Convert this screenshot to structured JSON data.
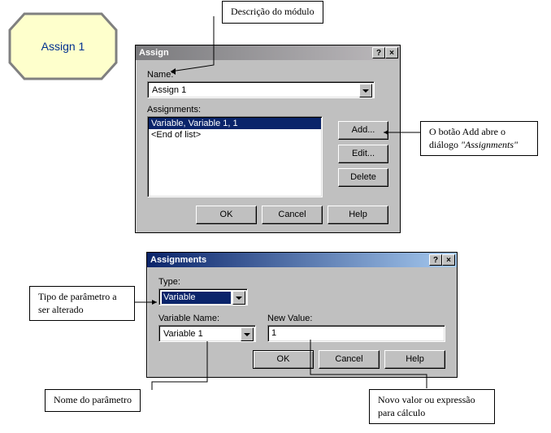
{
  "module": {
    "label": "Assign 1"
  },
  "annotations": {
    "module_desc": "Descrição do módulo",
    "add_button_note": "O botão Add abre o diálogo \"Assignments\"",
    "add_button_note_prefix": "O botão Add abre o diálogo ",
    "add_button_note_italic": "\"Assignments\"",
    "param_type": "Tipo de parâmetro a ser alterado",
    "param_name": "Nome do parâmetro",
    "new_value": "Novo valor ou expressão para cálculo"
  },
  "assignDialog": {
    "title": "Assign",
    "name_label": "Name:",
    "name_value": "Assign 1",
    "assignments_label": "Assignments:",
    "list": {
      "item0": "Variable, Variable 1, 1",
      "end": "<End of list>"
    },
    "buttons": {
      "add": "Add...",
      "edit": "Edit...",
      "delete": "Delete",
      "ok": "OK",
      "cancel": "Cancel",
      "help": "Help"
    }
  },
  "assignmentsDialog": {
    "title": "Assignments",
    "type_label": "Type:",
    "type_value": "Variable",
    "varname_label": "Variable Name:",
    "varname_value": "Variable 1",
    "newvalue_label": "New Value:",
    "newvalue_value": "1",
    "buttons": {
      "ok": "OK",
      "cancel": "Cancel",
      "help": "Help"
    }
  }
}
